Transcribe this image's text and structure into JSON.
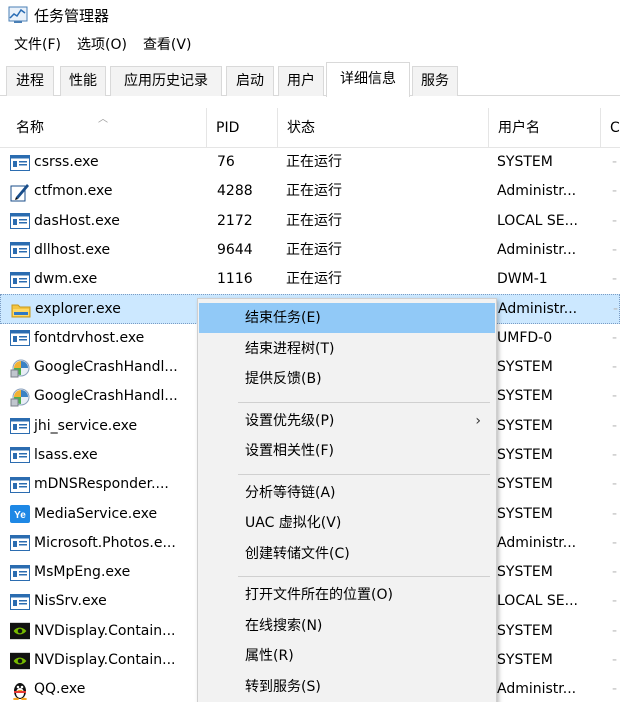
{
  "window": {
    "title": "任务管理器"
  },
  "menu": [
    "文件(F)",
    "选项(O)",
    "查看(V)"
  ],
  "tabs": [
    "进程",
    "性能",
    "应用历史记录",
    "启动",
    "用户",
    "详细信息",
    "服务"
  ],
  "active_tab": "详细信息",
  "columns": {
    "name": "名称",
    "pid": "PID",
    "status": "状态",
    "user": "用户名",
    "extra": "C"
  },
  "rows": [
    {
      "name": "csrss.exe",
      "pid": "76",
      "status": "正在运行",
      "user": "SYSTEM",
      "icon": "window-icon"
    },
    {
      "name": "ctfmon.exe",
      "pid": "4288",
      "status": "正在运行",
      "user": "Administr...",
      "icon": "pen-icon"
    },
    {
      "name": "dasHost.exe",
      "pid": "2172",
      "status": "正在运行",
      "user": "LOCAL SE...",
      "icon": "window-icon"
    },
    {
      "name": "dllhost.exe",
      "pid": "9644",
      "status": "正在运行",
      "user": "Administr...",
      "icon": "window-icon"
    },
    {
      "name": "dwm.exe",
      "pid": "1116",
      "status": "正在运行",
      "user": "DWM-1",
      "icon": "window-icon"
    },
    {
      "name": "explorer.exe",
      "pid": "",
      "status": "",
      "user": "Administr...",
      "icon": "folder-icon",
      "selected": true
    },
    {
      "name": "fontdrvhost.exe",
      "pid": "",
      "status": "",
      "user": "UMFD-0",
      "icon": "window-icon"
    },
    {
      "name": "GoogleCrashHandl...",
      "pid": "",
      "status": "",
      "user": "SYSTEM",
      "icon": "google-update-icon"
    },
    {
      "name": "GoogleCrashHandl...",
      "pid": "",
      "status": "",
      "user": "SYSTEM",
      "icon": "google-update-icon"
    },
    {
      "name": "jhi_service.exe",
      "pid": "",
      "status": "",
      "user": "SYSTEM",
      "icon": "window-icon"
    },
    {
      "name": "lsass.exe",
      "pid": "",
      "status": "",
      "user": "SYSTEM",
      "icon": "window-icon"
    },
    {
      "name": "mDNSResponder....",
      "pid": "",
      "status": "",
      "user": "SYSTEM",
      "icon": "window-icon"
    },
    {
      "name": "MediaService.exe",
      "pid": "",
      "status": "",
      "user": "SYSTEM",
      "icon": "media-service-icon"
    },
    {
      "name": "Microsoft.Photos.e...",
      "pid": "",
      "status": "",
      "user": "Administr...",
      "icon": "window-icon"
    },
    {
      "name": "MsMpEng.exe",
      "pid": "",
      "status": "",
      "user": "SYSTEM",
      "icon": "window-icon"
    },
    {
      "name": "NisSrv.exe",
      "pid": "",
      "status": "",
      "user": "LOCAL SE...",
      "icon": "window-icon"
    },
    {
      "name": "NVDisplay.Contain...",
      "pid": "",
      "status": "",
      "user": "SYSTEM",
      "icon": "nvidia-icon"
    },
    {
      "name": "NVDisplay.Contain...",
      "pid": "",
      "status": "",
      "user": "SYSTEM",
      "icon": "nvidia-icon"
    },
    {
      "name": "QQ.exe",
      "pid": "",
      "status": "",
      "user": "Administr...",
      "icon": "qq-penguin-icon"
    }
  ],
  "context_menu": {
    "items": [
      {
        "label": "结束任务(E)",
        "highlighted": true
      },
      {
        "label": "结束进程树(T)"
      },
      {
        "label": "提供反馈(B)"
      },
      {
        "separator": true
      },
      {
        "label": "设置优先级(P)",
        "submenu": true
      },
      {
        "label": "设置相关性(F)"
      },
      {
        "separator": true
      },
      {
        "label": "分析等待链(A)"
      },
      {
        "label": "UAC 虚拟化(V)"
      },
      {
        "label": "创建转储文件(C)"
      },
      {
        "separator": true
      },
      {
        "label": "打开文件所在的位置(O)"
      },
      {
        "label": "在线搜索(N)"
      },
      {
        "label": "属性(R)"
      },
      {
        "label": "转到服务(S)"
      }
    ],
    "submenu_arrow": "›"
  },
  "colors": {
    "selection": "#cce8ff",
    "menu_highlight": "#91c9f7",
    "menu_bg": "#f2f2f2"
  }
}
